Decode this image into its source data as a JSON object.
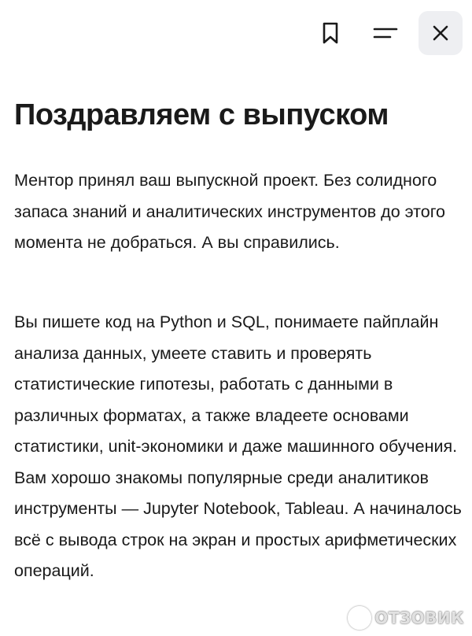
{
  "toolbar": {
    "icons": [
      "bookmark-icon",
      "menu-icon",
      "close-icon"
    ],
    "close_bg": "#eeeff2"
  },
  "article": {
    "title": "Поздравляем с выпуском",
    "paragraphs": [
      "Ментор принял ваш выпускной проект. Без солидного запаса знаний и аналитических инструментов до этого момента не добраться. А вы справились.",
      "Вы пишете код на Python и SQL, понимаете пайплайн анализа данных, умеете ставить и проверять статистические гипотезы, работать с данными в различных форматах, а также владеете основами статистики, unit-экономики и даже машинного обучения. Вам хорошо знакомы популярные среди аналитиков инструменты — Jupyter Notebook, Tableau. А начиналось всё с вывода строк на экран и простых арифметических операций."
    ]
  },
  "watermark": {
    "text": "ОТЗОВИК"
  }
}
